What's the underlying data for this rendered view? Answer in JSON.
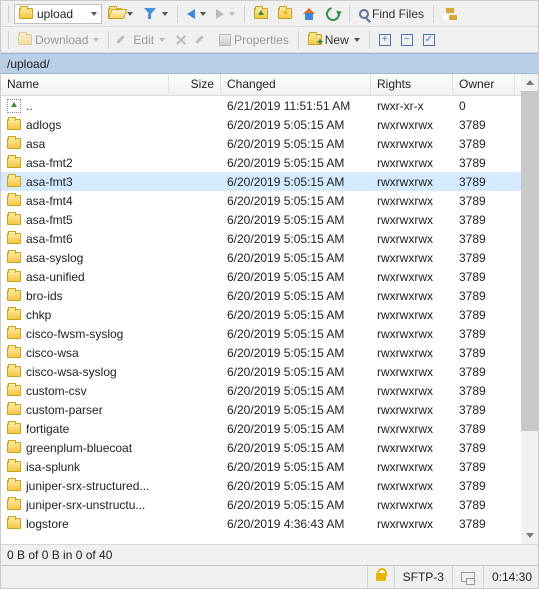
{
  "toolbar1": {
    "combo_label": "upload",
    "find_files": "Find Files"
  },
  "toolbar2": {
    "download": "Download",
    "edit": "Edit",
    "properties": "Properties",
    "new": "New"
  },
  "path": "/upload/",
  "columns": {
    "name": "Name",
    "size": "Size",
    "changed": "Changed",
    "rights": "Rights",
    "owner": "Owner"
  },
  "rows": [
    {
      "name": "..",
      "parent": true,
      "size": "",
      "changed": "6/21/2019 11:51:51 AM",
      "rights": "rwxr-xr-x",
      "owner": "0"
    },
    {
      "name": "adlogs",
      "size": "",
      "changed": "6/20/2019 5:05:15 AM",
      "rights": "rwxrwxrwx",
      "owner": "3789"
    },
    {
      "name": "asa",
      "size": "",
      "changed": "6/20/2019 5:05:15 AM",
      "rights": "rwxrwxrwx",
      "owner": "3789"
    },
    {
      "name": "asa-fmt2",
      "size": "",
      "changed": "6/20/2019 5:05:15 AM",
      "rights": "rwxrwxrwx",
      "owner": "3789"
    },
    {
      "name": "asa-fmt3",
      "size": "",
      "changed": "6/20/2019 5:05:15 AM",
      "rights": "rwxrwxrwx",
      "owner": "3789",
      "selected": true
    },
    {
      "name": "asa-fmt4",
      "size": "",
      "changed": "6/20/2019 5:05:15 AM",
      "rights": "rwxrwxrwx",
      "owner": "3789"
    },
    {
      "name": "asa-fmt5",
      "size": "",
      "changed": "6/20/2019 5:05:15 AM",
      "rights": "rwxrwxrwx",
      "owner": "3789"
    },
    {
      "name": "asa-fmt6",
      "size": "",
      "changed": "6/20/2019 5:05:15 AM",
      "rights": "rwxrwxrwx",
      "owner": "3789"
    },
    {
      "name": "asa-syslog",
      "size": "",
      "changed": "6/20/2019 5:05:15 AM",
      "rights": "rwxrwxrwx",
      "owner": "3789"
    },
    {
      "name": "asa-unified",
      "size": "",
      "changed": "6/20/2019 5:05:15 AM",
      "rights": "rwxrwxrwx",
      "owner": "3789"
    },
    {
      "name": "bro-ids",
      "size": "",
      "changed": "6/20/2019 5:05:15 AM",
      "rights": "rwxrwxrwx",
      "owner": "3789"
    },
    {
      "name": "chkp",
      "size": "",
      "changed": "6/20/2019 5:05:15 AM",
      "rights": "rwxrwxrwx",
      "owner": "3789"
    },
    {
      "name": "cisco-fwsm-syslog",
      "size": "",
      "changed": "6/20/2019 5:05:15 AM",
      "rights": "rwxrwxrwx",
      "owner": "3789"
    },
    {
      "name": "cisco-wsa",
      "size": "",
      "changed": "6/20/2019 5:05:15 AM",
      "rights": "rwxrwxrwx",
      "owner": "3789"
    },
    {
      "name": "cisco-wsa-syslog",
      "size": "",
      "changed": "6/20/2019 5:05:15 AM",
      "rights": "rwxrwxrwx",
      "owner": "3789"
    },
    {
      "name": "custom-csv",
      "size": "",
      "changed": "6/20/2019 5:05:15 AM",
      "rights": "rwxrwxrwx",
      "owner": "3789"
    },
    {
      "name": "custom-parser",
      "size": "",
      "changed": "6/20/2019 5:05:15 AM",
      "rights": "rwxrwxrwx",
      "owner": "3789"
    },
    {
      "name": "fortigate",
      "size": "",
      "changed": "6/20/2019 5:05:15 AM",
      "rights": "rwxrwxrwx",
      "owner": "3789"
    },
    {
      "name": "greenplum-bluecoat",
      "size": "",
      "changed": "6/20/2019 5:05:15 AM",
      "rights": "rwxrwxrwx",
      "owner": "3789"
    },
    {
      "name": "isa-splunk",
      "size": "",
      "changed": "6/20/2019 5:05:15 AM",
      "rights": "rwxrwxrwx",
      "owner": "3789"
    },
    {
      "name": "juniper-srx-structured...",
      "size": "",
      "changed": "6/20/2019 5:05:15 AM",
      "rights": "rwxrwxrwx",
      "owner": "3789"
    },
    {
      "name": "juniper-srx-unstructu...",
      "size": "",
      "changed": "6/20/2019 5:05:15 AM",
      "rights": "rwxrwxrwx",
      "owner": "3789"
    },
    {
      "name": "logstore",
      "size": "",
      "changed": "6/20/2019 4:36:43 AM",
      "rights": "rwxrwxrwx",
      "owner": "3789"
    }
  ],
  "status": "0 B of 0 B in 0 of 40",
  "footer": {
    "protocol": "SFTP-3",
    "time": "0:14:30"
  }
}
